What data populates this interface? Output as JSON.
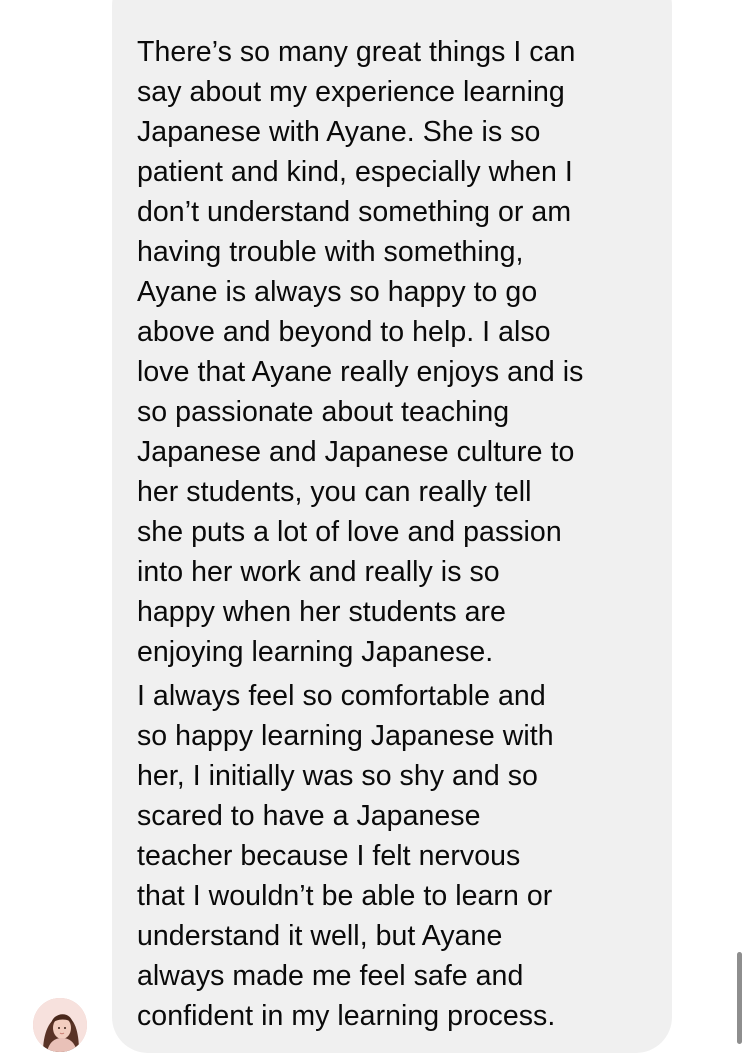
{
  "message": {
    "paragraphs": [
      "There’s so many great things I can\nsay about my experience learning\nJapanese with Ayane. She is so\npatient and kind, especially when I\ndon’t understand something or am\nhaving trouble with something,\nAyane is always so happy to go\nabove and beyond to help. I also\nlove that Ayane really enjoys and is\nso passionate about teaching\nJapanese and Japanese culture to\nher students, you can really tell\nshe puts a lot of love and passion\ninto her work and really is so\nhappy when her students are\nenjoying learning Japanese.",
      "I always feel so comfortable and\nso happy learning Japanese with\nher, I initially was so shy and so\nscared to have a Japanese\nteacher because I felt nervous\nthat I wouldn’t be able to learn or\nunderstand it well, but Ayane\nalways made me feel safe and\nconfident in my learning process."
    ]
  },
  "sender": {
    "avatar_icon": "profile-photo-avatar"
  },
  "colors": {
    "bubble": "#f0f0f0",
    "text": "#0a0a0a",
    "scrollbar": "#8e8e8e",
    "background": "#ffffff"
  }
}
